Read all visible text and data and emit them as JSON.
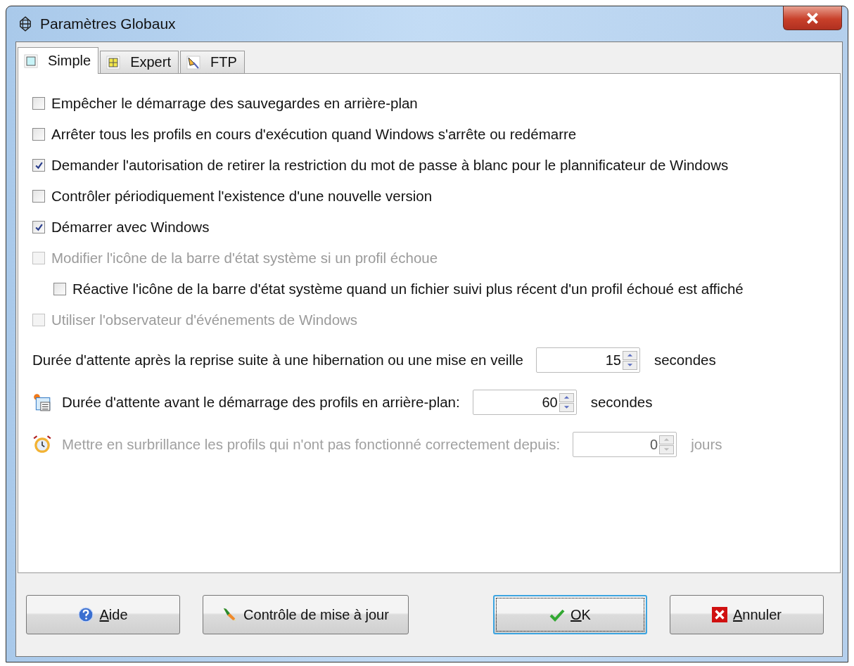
{
  "window": {
    "title": "Paramètres Globaux"
  },
  "tabs": [
    {
      "label": "Simple",
      "kind": "simple",
      "selected": true
    },
    {
      "label": "Expert",
      "kind": "grid",
      "selected": false
    },
    {
      "label": "FTP",
      "kind": "ftp",
      "selected": false
    }
  ],
  "options": [
    {
      "label": "Empêcher le démarrage des sauvegardes en arrière-plan",
      "checked": false,
      "disabled": false
    },
    {
      "label": "Arrêter tous les profils en cours d'exécution quand Windows s'arrête ou redémarre",
      "checked": false,
      "disabled": false
    },
    {
      "label": "Demander l'autorisation de retirer la restriction du mot de passe à blanc pour le plannificateur de Windows",
      "checked": true,
      "disabled": false
    },
    {
      "label": "Contrôler périodiquement l'existence d'une nouvelle version",
      "checked": false,
      "disabled": false
    },
    {
      "label": "Démarrer avec Windows",
      "checked": true,
      "disabled": false
    },
    {
      "label": "Modifier l'icône de la barre d'état système si un profil échoue",
      "checked": false,
      "disabled": true,
      "children": [
        {
          "label": "Réactive l'icône de la barre d'état système quand un fichier suivi plus récent d'un profil échoué est affiché",
          "checked": false,
          "disabled": false
        }
      ]
    },
    {
      "label": "Utiliser l'observateur d'événements de Windows",
      "checked": false,
      "disabled": true
    }
  ],
  "delays": [
    {
      "kind": "plain",
      "label": "Durée d'attente après la reprise suite à une hibernation ou une mise en veille",
      "value": "15",
      "unit": "secondes",
      "disabled": false
    },
    {
      "kind": "schedule",
      "label": "Durée d'attente avant le démarrage des profils en arrière-plan:",
      "value": "60",
      "unit": "secondes",
      "disabled": false
    },
    {
      "kind": "alarm",
      "label": "Mettre en surbrillance les profils qui n'ont pas fonctionné correctement depuis:",
      "value": "0",
      "unit": "jours",
      "disabled": true
    }
  ],
  "buttons": [
    {
      "kind": "help",
      "key": "A",
      "rest": "ide",
      "focused": false
    },
    {
      "kind": "update",
      "rest": "Contrôle de mise à jour",
      "focused": false
    },
    {
      "kind": "ok",
      "key": "O",
      "rest": "K",
      "focused": true
    },
    {
      "kind": "cancel",
      "key": "A",
      "rest": "nnuler",
      "focused": false
    }
  ]
}
